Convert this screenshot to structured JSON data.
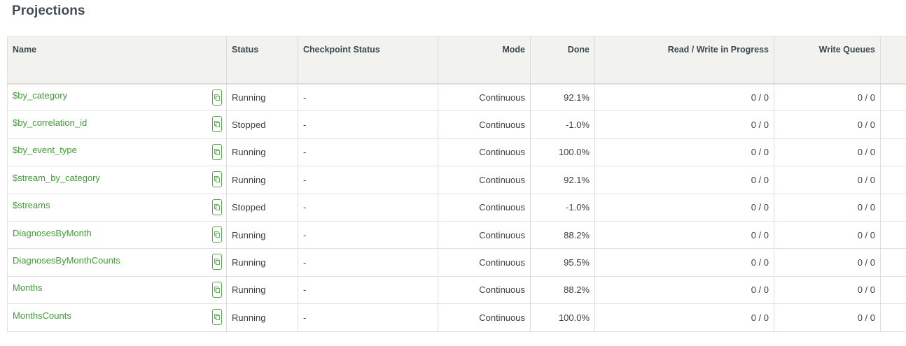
{
  "page": {
    "title": "Projections"
  },
  "table": {
    "headers": {
      "name": "Name",
      "status": "Status",
      "checkpoint_status": "Checkpoint Status",
      "mode": "Mode",
      "done": "Done",
      "read_write": "Read / Write in Progress",
      "write_queues": "Write Queues"
    },
    "rows": [
      {
        "name": "$by_category",
        "status": "Running",
        "checkpoint": "-",
        "mode": "Continuous",
        "done": "92.1%",
        "rw": "0 / 0",
        "wq": "0 / 0"
      },
      {
        "name": "$by_correlation_id",
        "status": "Stopped",
        "checkpoint": "-",
        "mode": "Continuous",
        "done": "-1.0%",
        "rw": "0 / 0",
        "wq": "0 / 0"
      },
      {
        "name": "$by_event_type",
        "status": "Running",
        "checkpoint": "-",
        "mode": "Continuous",
        "done": "100.0%",
        "rw": "0 / 0",
        "wq": "0 / 0"
      },
      {
        "name": "$stream_by_category",
        "status": "Running",
        "checkpoint": "-",
        "mode": "Continuous",
        "done": "92.1%",
        "rw": "0 / 0",
        "wq": "0 / 0"
      },
      {
        "name": "$streams",
        "status": "Stopped",
        "checkpoint": "-",
        "mode": "Continuous",
        "done": "-1.0%",
        "rw": "0 / 0",
        "wq": "0 / 0"
      },
      {
        "name": "DiagnosesByMonth",
        "status": "Running",
        "checkpoint": "-",
        "mode": "Continuous",
        "done": "88.2%",
        "rw": "0 / 0",
        "wq": "0 / 0"
      },
      {
        "name": "DiagnosesByMonthCounts",
        "status": "Running",
        "checkpoint": "-",
        "mode": "Continuous",
        "done": "95.5%",
        "rw": "0 / 0",
        "wq": "0 / 0"
      },
      {
        "name": "Months",
        "status": "Running",
        "checkpoint": "-",
        "mode": "Continuous",
        "done": "88.2%",
        "rw": "0 / 0",
        "wq": "0 / 0"
      },
      {
        "name": "MonthsCounts",
        "status": "Running",
        "checkpoint": "-",
        "mode": "Continuous",
        "done": "100.0%",
        "rw": "0 / 0",
        "wq": "0 / 0"
      }
    ]
  },
  "colors": {
    "link": "#3f9c35",
    "header_bg": "#f2f3ef"
  },
  "icons": {
    "copy": "copy-icon"
  }
}
